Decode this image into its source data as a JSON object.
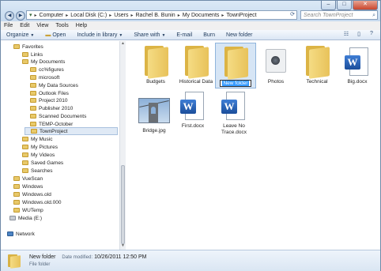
{
  "window": {
    "controls": [
      "–",
      "□",
      "✕"
    ]
  },
  "address": {
    "crumbs": [
      "Computer",
      "Local Disk (C:)",
      "Users",
      "Rachel B. Bunin",
      "My Documents",
      "TownProject"
    ],
    "search_placeholder": "Search TownProject"
  },
  "menu": [
    "File",
    "Edit",
    "View",
    "Tools",
    "Help"
  ],
  "toolbar": {
    "organize": "Organize",
    "open": "Open",
    "include": "Include in library",
    "share": "Share with",
    "email": "E-mail",
    "burn": "Burn",
    "new_folder": "New folder"
  },
  "tree": [
    {
      "label": "Favorites"
    },
    {
      "label": "Links"
    },
    {
      "label": "My Documents"
    },
    {
      "label": "cc%figures"
    },
    {
      "label": "microsoft"
    },
    {
      "label": "My Data Sources"
    },
    {
      "label": "Outlook Files"
    },
    {
      "label": "Project 2010"
    },
    {
      "label": "Publisher 2010"
    },
    {
      "label": "Scanned Documents"
    },
    {
      "label": "TEMP-October"
    },
    {
      "label": "TownProject"
    },
    {
      "label": "My Music"
    },
    {
      "label": "My Pictures"
    },
    {
      "label": "My Videos"
    },
    {
      "label": "Saved Games"
    },
    {
      "label": "Searches"
    },
    {
      "label": "VueScan"
    },
    {
      "label": "Windows"
    },
    {
      "label": "Windows.old"
    },
    {
      "label": "Windows.old.000"
    },
    {
      "label": "WUTemp"
    },
    {
      "label": "Media (E:)"
    },
    {
      "label": "Network"
    }
  ],
  "files": [
    {
      "label": "Budgets"
    },
    {
      "label": "Historical Data"
    },
    {
      "label": "New folder"
    },
    {
      "label": "Photos"
    },
    {
      "label": "Technical"
    },
    {
      "label": "Big.docx"
    },
    {
      "label": "Bridge.jpg"
    },
    {
      "label": "First.docx"
    },
    {
      "label": "Leave No Trace.docx"
    }
  ],
  "details": {
    "name": "New folder",
    "modified_label": "Date modified:",
    "modified_value": "10/26/2011 12:50 PM",
    "type": "File folder"
  }
}
